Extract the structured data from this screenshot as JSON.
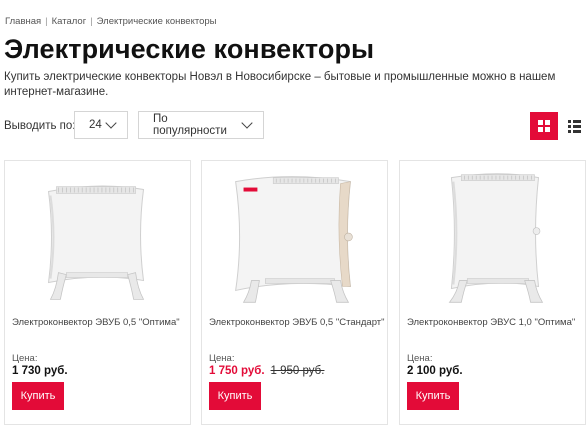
{
  "breadcrumb": {
    "items": [
      "Главная",
      "Каталог",
      "Электрические конвекторы"
    ],
    "separator": "|"
  },
  "page": {
    "title": "Электрические конвекторы",
    "description": "Купить электрические конвекторы Новэл в Новосибирске – бытовые и промышленные можно в нашем интернет-магазине."
  },
  "toolbar": {
    "show_label": "Выводить по:",
    "count_value": "24",
    "sort_value": "По популярности",
    "active_view": "grid"
  },
  "colors": {
    "accent": "#e30b38"
  },
  "products": [
    {
      "title": "Электроконвектор ЭВУБ 0,5 \"Оптима\"",
      "price_label": "Цена:",
      "price": "1 730 руб.",
      "old_price": "",
      "buy_label": "Купить",
      "image": "white-convector-heater-icon"
    },
    {
      "title": "Электроконвектор ЭВУБ 0,5 \"Стандарт\"",
      "price_label": "Цена:",
      "price": "1 750 руб.",
      "old_price": "1 950 руб.",
      "buy_label": "Купить",
      "image": "white-convector-heater-icon"
    },
    {
      "title": "Электроконвектор ЭВУС 1,0 \"Оптима\"",
      "price_label": "Цена:",
      "price": "2 100 руб.",
      "old_price": "",
      "buy_label": "Купить",
      "image": "white-convector-heater-icon"
    }
  ]
}
